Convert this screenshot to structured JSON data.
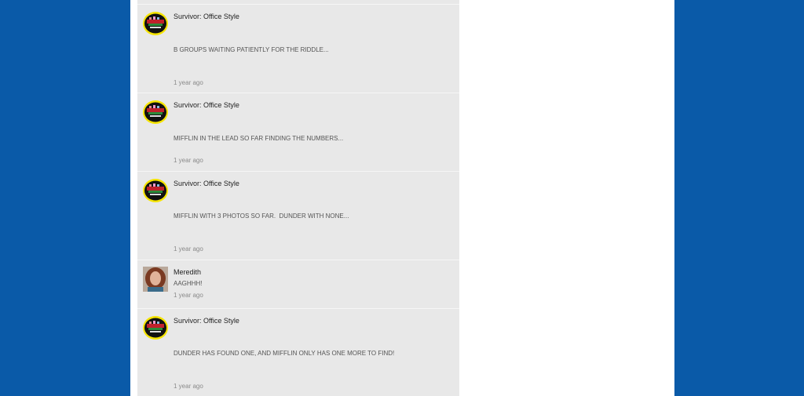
{
  "feed": {
    "posts": [
      {
        "author": "Survivor: Office Style",
        "avatar_icon": "survivor-logo-avatar",
        "body": "B GROUPS WAITING PATIENTLY FOR THE RIDDLE...",
        "time": "1 year ago"
      },
      {
        "author": "Survivor: Office Style",
        "avatar_icon": "survivor-logo-avatar",
        "body": "MIFFLIN IN THE LEAD SO FAR FINDING THE NUMBERS...",
        "time": "1 year ago"
      },
      {
        "author": "Survivor: Office Style",
        "avatar_icon": "survivor-logo-avatar",
        "body": "MIFFLIN WITH 3 PHOTOS SO FAR.  DUNDER WITH NONE...",
        "time": "1 year ago"
      },
      {
        "author": "Meredith",
        "avatar_icon": "user-photo-avatar",
        "body": "AAGHHH!",
        "time": "1 year ago"
      },
      {
        "author": "Survivor: Office Style",
        "avatar_icon": "survivor-logo-avatar",
        "body": "DUNDER HAS FOUND ONE, AND MIFFLIN ONLY HAS ONE MORE TO FIND!",
        "time": "1 year ago"
      }
    ]
  },
  "colors": {
    "page_background": "#0a5aa8",
    "content_background": "#ffffff",
    "feed_background": "#e8e8e8",
    "logo_yellow": "#f5e400"
  }
}
